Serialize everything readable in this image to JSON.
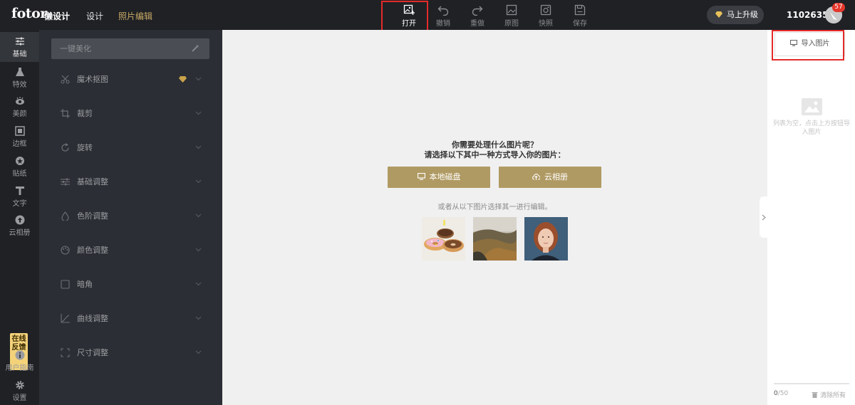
{
  "brand": {
    "logo": "fotor",
    "product": "懒设计"
  },
  "nav": {
    "design": "设计",
    "photo_edit": "照片编辑"
  },
  "toolbar": {
    "open": "打开",
    "undo": "撤销",
    "redo": "重做",
    "original": "原图",
    "snapshot": "快照",
    "save": "保存"
  },
  "account": {
    "upgrade": "马上升级",
    "user_id": "11026354",
    "notifications": "57"
  },
  "rail": {
    "basic": "基础",
    "effects": "特效",
    "beauty": "美颜",
    "frame": "边框",
    "sticker": "贴纸",
    "text": "文字",
    "cloud": "云相册",
    "feedback": "在线反馈",
    "guide": "用户指南",
    "settings": "设置"
  },
  "panel": {
    "beautify": "一键美化",
    "items": [
      "魔术抠图",
      "裁剪",
      "旋转",
      "基础调整",
      "色阶调整",
      "颜色调整",
      "暗角",
      "曲线调整",
      "尺寸调整"
    ]
  },
  "canvas": {
    "question": "你需要处理什么图片呢？",
    "prompt": "请选择以下其中一种方式导入你的图片：",
    "local_disk": "本地磁盘",
    "cloud_album": "云相册",
    "or_text": "或者从以下图片选择其一进行编辑。"
  },
  "right_panel": {
    "import": "导入图片",
    "empty": "列表为空，点击上方按钮导入图片",
    "count": "0",
    "max": "/50",
    "clear_all": "清除所有"
  },
  "colors": {
    "accent_gold": "#b09a63",
    "dark_bg": "#1f2125",
    "panel_bg": "#2b2e34",
    "highlight_red": "#e42a2a"
  }
}
